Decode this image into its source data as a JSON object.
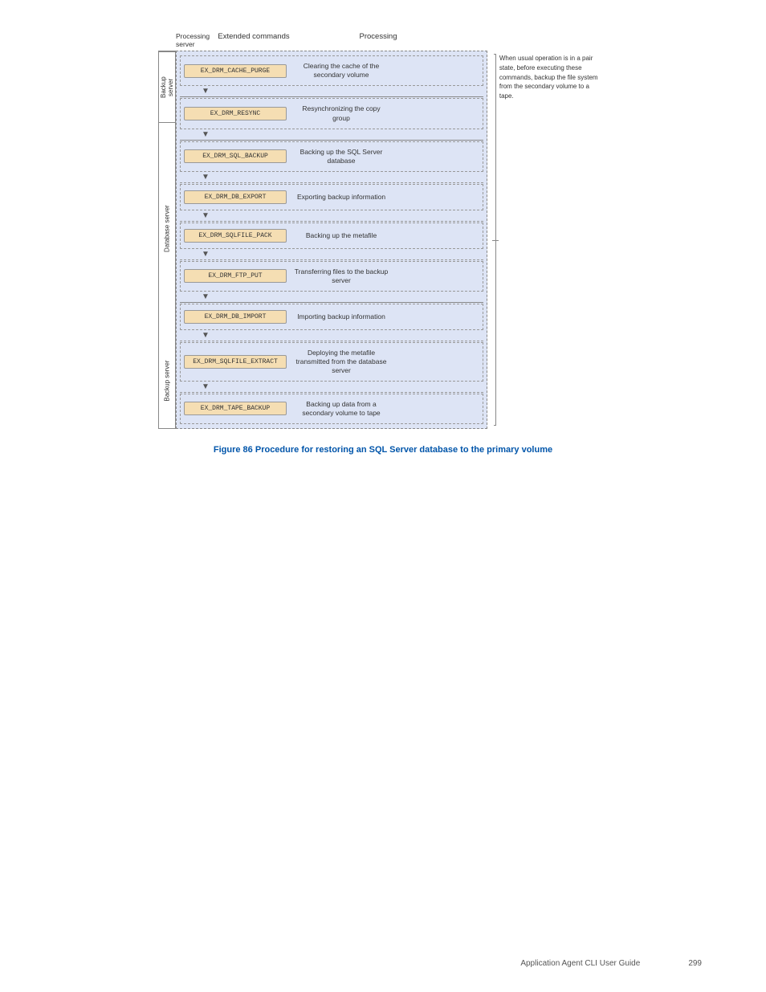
{
  "page": {
    "title": "Application Agent CLI User Guide",
    "page_number": "299"
  },
  "figure": {
    "caption": "Figure 86 Procedure for restoring an SQL Server database to the primary volume"
  },
  "diagram": {
    "col_headers": {
      "processing_server": "Processing server",
      "extended_commands": "Extended commands",
      "processing": "Processing"
    },
    "servers": [
      {
        "id": "backup-server-top",
        "label": "Backup server"
      },
      {
        "id": "database-server",
        "label": "Database server"
      },
      {
        "id": "backup-server-bottom",
        "label": "Backup server"
      }
    ],
    "commands": [
      {
        "group": "backup-server-top",
        "items": [
          {
            "cmd": "EX_DRM_CACHE_PURGE",
            "desc": "Clearing the cache of the secondary volume"
          }
        ]
      },
      {
        "group": "separator",
        "items": [
          {
            "cmd": "EX_DRM_RESYNC",
            "desc": "Resynchronizing the copy group"
          }
        ]
      },
      {
        "group": "database-server",
        "items": [
          {
            "cmd": "EX_DRM_SQL_BACKUP",
            "desc": "Backing up the SQL Server database"
          },
          {
            "cmd": "EX_DRM_DB_EXPORT",
            "desc": "Exporting backup information"
          },
          {
            "cmd": "EX_DRM_SQLFILE_PACK",
            "desc": "Backing up the metafile"
          },
          {
            "cmd": "EX_DRM_FTP_PUT",
            "desc": "Transferring files to the backup server"
          }
        ]
      },
      {
        "group": "backup-server-bottom",
        "items": [
          {
            "cmd": "EX_DRM_DB_IMPORT",
            "desc": "Importing backup information"
          },
          {
            "cmd": "EX_DRM_SQLFILE_EXTRACT",
            "desc": "Deploying the metafile transmitted from the database server"
          },
          {
            "cmd": "EX_DRM_TAPE_BACKUP",
            "desc": "Backing up data from a secondary volume to tape"
          }
        ]
      }
    ],
    "note": "When usual operation is in a pair state, before executing these commands, backup the file system from the secondary volume to a tape."
  }
}
